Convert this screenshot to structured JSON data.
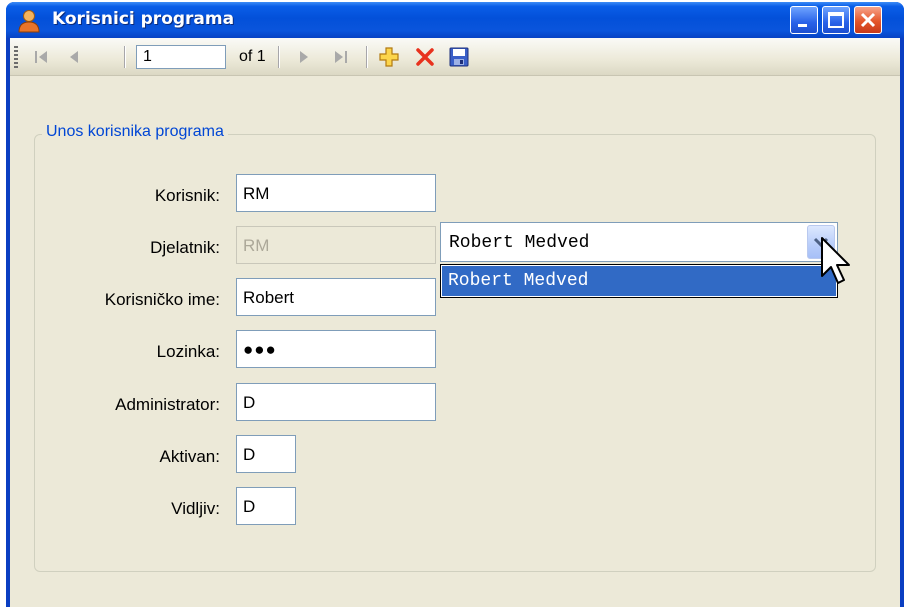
{
  "window": {
    "title": "Korisnici programa"
  },
  "navigator": {
    "position_value": "1",
    "of_label": "of 1",
    "icons": [
      "move-first-icon",
      "move-previous-icon",
      "move-next-icon",
      "move-last-icon",
      "add-new-icon",
      "delete-icon",
      "save-icon"
    ]
  },
  "group": {
    "title": "Unos korisnika programa"
  },
  "form": {
    "korisnik": {
      "label": "Korisnik:",
      "value": "RM"
    },
    "djelatnik": {
      "label": "Djelatnik:",
      "value": "RM"
    },
    "korisnicko_ime": {
      "label": "Korisničko ime:",
      "value": "Robert"
    },
    "lozinka": {
      "label": "Lozinka:",
      "value": "●●●"
    },
    "administrator": {
      "label": "Administrator:",
      "value": "D"
    },
    "aktivan": {
      "label": "Aktivan:",
      "value": "D"
    },
    "vidljiv": {
      "label": "Vidljiv:",
      "value": "D"
    }
  },
  "djelatnik_combo": {
    "selected": "Robert Medved",
    "options": [
      "Robert Medved"
    ]
  },
  "colors": {
    "titlebar": "#0350d9",
    "client": "#ece9d8",
    "selection": "#316ac5",
    "group_title": "#0046d5"
  }
}
